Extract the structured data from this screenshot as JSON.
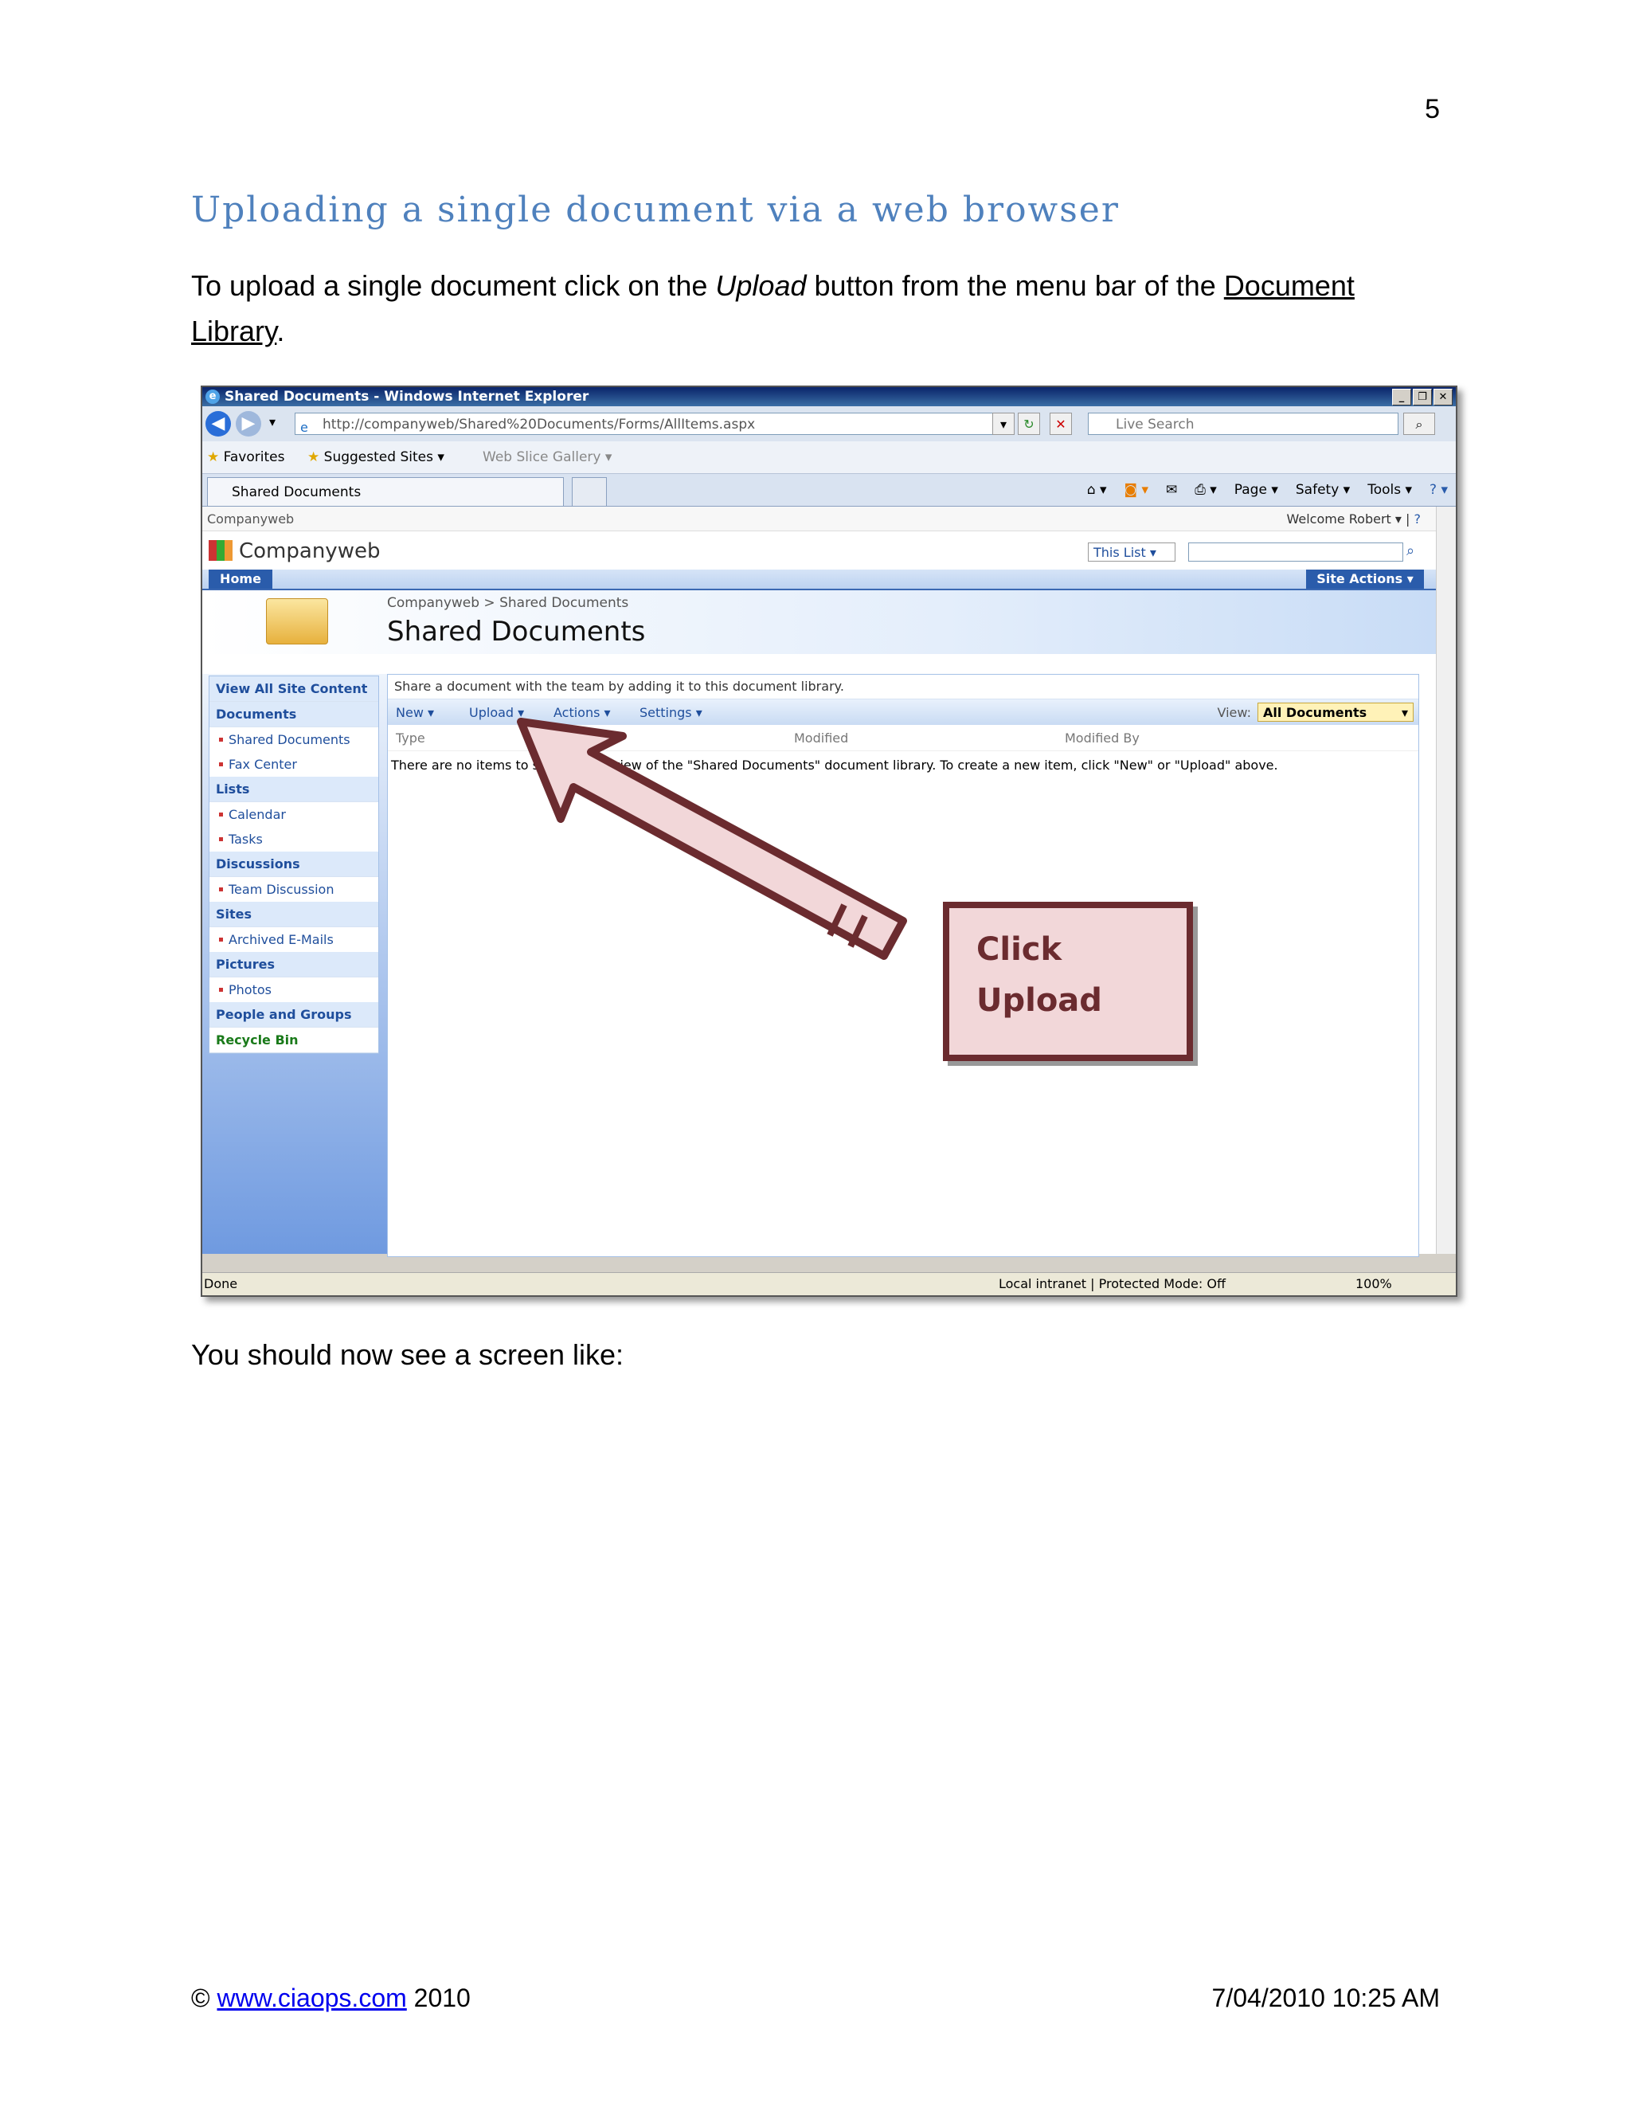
{
  "page_number": "5",
  "heading": "Uploading a single document via a web browser",
  "intro": {
    "before": "To upload a single document click on the ",
    "emph": "Upload",
    "middle": " button from the menu bar of the ",
    "link": "Document Library",
    "after": "."
  },
  "after_shot_text": "You should now see a screen like:",
  "footer": {
    "copyright": "©",
    "link": "www.ciaops.com",
    "year": "2010",
    "datetime": "7/04/2010 10:25 AM"
  },
  "browser": {
    "window_title": "Shared Documents - Windows Internet Explorer",
    "address": "http://companyweb/Shared%20Documents/Forms/AllItems.aspx",
    "search_placeholder": "Live Search",
    "favorites": "Favorites",
    "suggested_sites": "Suggested Sites ▾",
    "web_slice": "Web Slice Gallery ▾",
    "tab_title": "Shared Documents",
    "cmd": [
      "Page ▾",
      "Safety ▾",
      "Tools ▾"
    ],
    "status_done": "Done",
    "status_zone": "Local intranet | Protected Mode: Off",
    "status_zoom": "100%"
  },
  "sharepoint": {
    "top_left": "Companyweb",
    "welcome": "Welcome Robert ▾",
    "site_name": "Companyweb",
    "scope": "This List",
    "home": "Home",
    "site_actions": "Site Actions ▾",
    "breadcrumb": "Companyweb > Shared Documents",
    "page_title": "Shared Documents",
    "quick_launch": [
      {
        "label": "View All Site Content",
        "type": "hdr"
      },
      {
        "label": "Documents",
        "type": "hdr"
      },
      {
        "label": "Shared Documents",
        "type": "sub"
      },
      {
        "label": "Fax Center",
        "type": "sub"
      },
      {
        "label": "Lists",
        "type": "hdr"
      },
      {
        "label": "Calendar",
        "type": "sub"
      },
      {
        "label": "Tasks",
        "type": "sub"
      },
      {
        "label": "Discussions",
        "type": "hdr"
      },
      {
        "label": "Team Discussion",
        "type": "sub"
      },
      {
        "label": "Sites",
        "type": "hdr"
      },
      {
        "label": "Archived E-Mails",
        "type": "sub"
      },
      {
        "label": "Pictures",
        "type": "hdr"
      },
      {
        "label": "Photos",
        "type": "sub"
      },
      {
        "label": "People and Groups",
        "type": "hdr"
      },
      {
        "label": "Recycle Bin",
        "type": "rb"
      }
    ],
    "description": "Share a document with the team by adding it to this document library.",
    "toolbar": [
      "New ▾",
      "Upload ▾",
      "Actions ▾",
      "Settings ▾"
    ],
    "view_label": "View:",
    "view_value": "All Documents",
    "columns": [
      "Type",
      "Modified",
      "Modified By"
    ],
    "empty_message": "There are no items to show in this view of the \"Shared Documents\" document library. To create a new item, click \"New\" or \"Upload\" above."
  },
  "callout": {
    "line1": "Click",
    "line2": "Upload"
  },
  "colors": {
    "heading": "#4f81bd",
    "callout_fill": "#f2d7d9",
    "callout_border": "#6b2b2f",
    "sp_blue": "#2a5cab"
  }
}
